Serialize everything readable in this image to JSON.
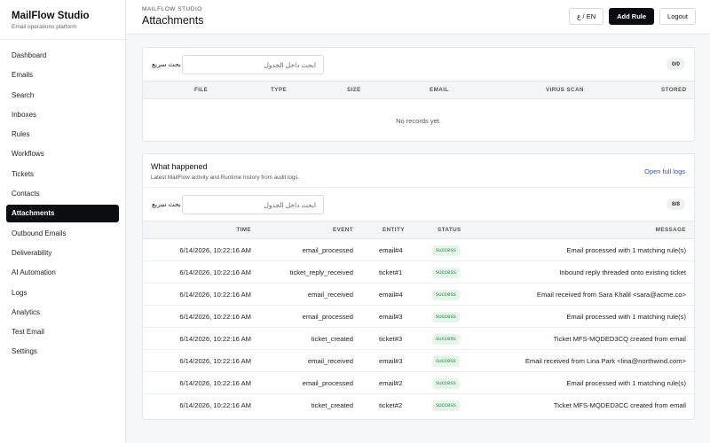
{
  "brand": {
    "title": "MailFlow Studio",
    "subtitle": "Email operations platform"
  },
  "nav": [
    {
      "label": "Dashboard"
    },
    {
      "label": "Emails"
    },
    {
      "label": "Search"
    },
    {
      "label": "Inboxes"
    },
    {
      "label": "Rules"
    },
    {
      "label": "Workflows"
    },
    {
      "label": "Tickets"
    },
    {
      "label": "Contacts"
    },
    {
      "label": "Attachments",
      "active": true
    },
    {
      "label": "Outbound Emails"
    },
    {
      "label": "Deliverability"
    },
    {
      "label": "AI Automation"
    },
    {
      "label": "Logs"
    },
    {
      "label": "Analytics"
    },
    {
      "label": "Test Email"
    },
    {
      "label": "Settings"
    }
  ],
  "header": {
    "eyebrow": "MAILFLOW STUDIO",
    "title": "Attachments",
    "lang_label": "ع / EN",
    "add_rule_label": "Add Rule",
    "logout_label": "Logout"
  },
  "attachments": {
    "search_label": "بحث سريع",
    "search_placeholder": "ابحث داخل الجدول",
    "count": "0/0",
    "columns": [
      "FILE",
      "TYPE",
      "SIZE",
      "EMAIL",
      "VIRUS SCAN",
      "STORED"
    ],
    "empty_text": "No records yet."
  },
  "activity": {
    "title": "What happened",
    "subtitle": "Latest MailFlow activity and Runtime history from audit logs.",
    "link_label": "Open full logs",
    "search_label": "بحث سريع",
    "search_placeholder": "ابحث داخل الجدول",
    "count": "8/8",
    "columns": [
      "TIME",
      "EVENT",
      "ENTITY",
      "STATUS",
      "MESSAGE"
    ],
    "rows": [
      {
        "time": "6/14/2026, 10:22:16 AM",
        "event": "email_processed",
        "entity": "email#4",
        "status": "success",
        "message": "Email processed with 1 matching rule(s)"
      },
      {
        "time": "6/14/2026, 10:22:16 AM",
        "event": "ticket_reply_received",
        "entity": "ticket#1",
        "status": "success",
        "message": "Inbound reply threaded onto existing ticket"
      },
      {
        "time": "6/14/2026, 10:22:16 AM",
        "event": "email_received",
        "entity": "email#4",
        "status": "success",
        "message": "Email received from Sara Khalil <sara@acme.co>"
      },
      {
        "time": "6/14/2026, 10:22:16 AM",
        "event": "email_processed",
        "entity": "email#3",
        "status": "success",
        "message": "Email processed with 1 matching rule(s)"
      },
      {
        "time": "6/14/2026, 10:22:16 AM",
        "event": "ticket_created",
        "entity": "ticket#3",
        "status": "success",
        "message": "Ticket MFS-MQDED3CQ created from email"
      },
      {
        "time": "6/14/2026, 10:22:16 AM",
        "event": "email_received",
        "entity": "email#3",
        "status": "success",
        "message": "Email received from Lina Park <lina@northwind.com>"
      },
      {
        "time": "6/14/2026, 10:22:16 AM",
        "event": "email_processed",
        "entity": "email#2",
        "status": "success",
        "message": "Email processed with 1 matching rule(s)"
      },
      {
        "time": "6/14/2026, 10:22:16 AM",
        "event": "ticket_created",
        "entity": "ticket#2",
        "status": "success",
        "message": "Ticket MFS-MQDED3CC created from email"
      }
    ]
  }
}
